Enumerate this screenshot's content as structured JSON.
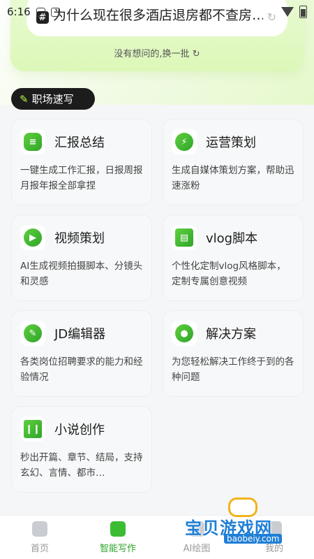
{
  "status_bar": {
    "time": "6:16"
  },
  "hero": {
    "hot_question": "为什么现在很多酒店退房都不查房…",
    "swap_label": "没有想问的,换一批"
  },
  "section": {
    "title": "职场速写"
  },
  "cards": [
    {
      "title": "汇报总结",
      "desc": "一键生成工作汇报，日报周报月报年报全部拿捏"
    },
    {
      "title": "运营策划",
      "desc": "生成自媒体策划方案，帮助迅速涨粉"
    },
    {
      "title": "视频策划",
      "desc": "AI生成视频拍摄脚本、分镜头和灵感"
    },
    {
      "title": "vlog脚本",
      "desc": "个性化定制vlog风格脚本，定制专属创意视频"
    },
    {
      "title": "JD编辑器",
      "desc": "各类岗位招聘要求的能力和经验情况"
    },
    {
      "title": "解决方案",
      "desc": "为您轻松解决工作终于到的各种问题"
    },
    {
      "title": "小说创作",
      "desc": "秒出开篇、章节、结局，支持玄幻、言情、都市…"
    }
  ],
  "bottom_nav": [
    {
      "label": "首页"
    },
    {
      "label": "智能写作"
    },
    {
      "label": "AI绘图"
    },
    {
      "label": "我的"
    }
  ],
  "watermark": {
    "text": "宝贝游戏网",
    "url": "baobeiy.com"
  },
  "colors": {
    "accent": "#3cbc33",
    "tag_bg": "#1c1c1c",
    "hero": "#dcf8b8"
  }
}
